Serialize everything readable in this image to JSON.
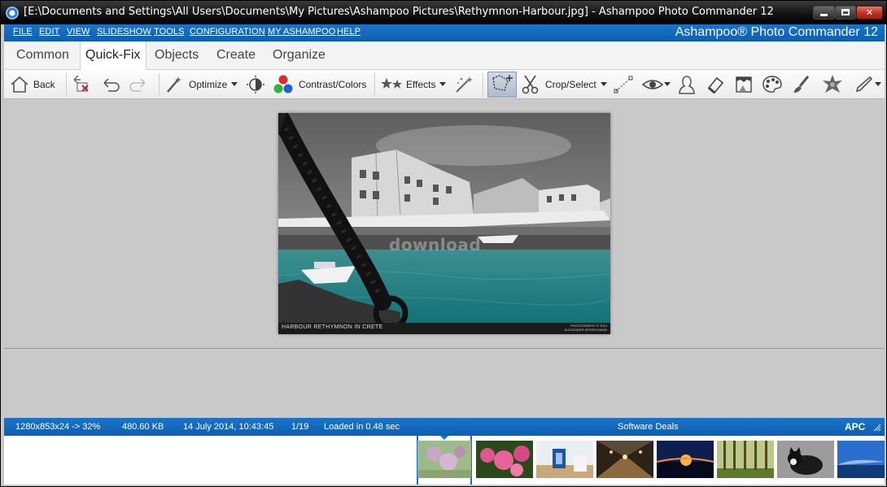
{
  "window": {
    "title": "[E:\\Documents and Settings\\All Users\\Documents\\My Pictures\\Ashampoo Pictures\\Rethymnon-Harbour.jpg] - Ashampoo Photo Commander 12"
  },
  "menu": {
    "items": [
      "FILE",
      "EDIT",
      "VIEW",
      "SLIDESHOW",
      "TOOLS",
      "CONFIGURATION",
      "MY ASHAMPOO",
      "HELP"
    ],
    "brand": "Ashampoo® Photo Commander 12"
  },
  "tabs": [
    "Common",
    "Quick-Fix",
    "Objects",
    "Create",
    "Organize"
  ],
  "toolbar": {
    "back": "Back",
    "optimize": "Optimize",
    "contrast": "Contrast/Colors",
    "effects": "Effects",
    "crop": "Crop/Select"
  },
  "photo": {
    "caption": "HARBOUR RETHYMNON IN CRETE",
    "credit_line1": "PHOTOGRAPHY © 2014",
    "credit_line2": "ALEXANDER KESSELMANN",
    "watermark": "download"
  },
  "status": {
    "dimensions": "1280x853x24 -> 32%",
    "filesize": "480.60 KB",
    "date": "14 July 2014, 10:43:45",
    "position": "1/19",
    "loadtime": "Loaded in 0.48 sec",
    "deals": "Software Deals",
    "apc": "APC"
  },
  "icons": [
    "back-icon",
    "delete-icon",
    "undo-icon",
    "redo-icon",
    "optimize-wand-icon",
    "brightness-icon",
    "color-dots-icon",
    "effects-stars-icon",
    "sparkle-brush-icon",
    "crop-select-icon",
    "scissors-icon",
    "line-tool-icon",
    "eye-icon",
    "portrait-icon",
    "eraser-icon",
    "frame-icon",
    "palette-icon",
    "brush-icon",
    "blur-star-icon",
    "pen-icon"
  ],
  "colors": {
    "accent": "#1569bd",
    "titlebar": "#111111"
  }
}
